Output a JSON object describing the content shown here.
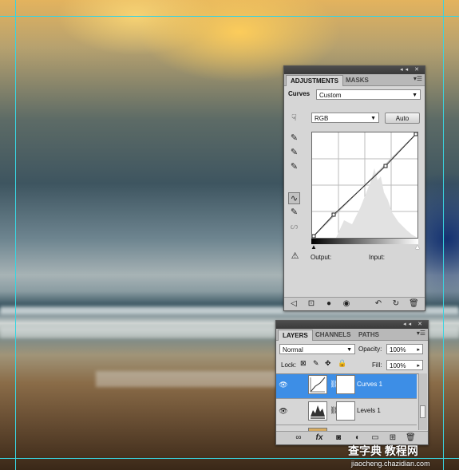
{
  "adjustments_panel": {
    "tabs": [
      {
        "label": "ADJUSTMENTS"
      },
      {
        "label": "MASKS"
      }
    ],
    "curves_label": "Curves",
    "preset_value": "Custom",
    "channel_value": "RGB",
    "auto_label": "Auto",
    "output_label": "Output:",
    "input_label": "Input:"
  },
  "layers_panel": {
    "tabs": [
      {
        "label": "LAYERS"
      },
      {
        "label": "CHANNELS"
      },
      {
        "label": "PATHS"
      }
    ],
    "blend_mode": "Normal",
    "opacity_label": "Opacity:",
    "opacity_value": "100%",
    "lock_label": "Lock:",
    "fill_label": "Fill:",
    "fill_value": "100%",
    "layers": [
      {
        "name": "Curves 1",
        "selected": true
      },
      {
        "name": "Levels 1",
        "selected": false
      }
    ]
  },
  "watermark": {
    "brand": "查字典 教程网",
    "url": "jiaocheng.chazidian.com"
  },
  "colors": {
    "selection": "#3d8ee6",
    "guide": "#39d4e0",
    "panel_bg": "#d6d6d6"
  }
}
